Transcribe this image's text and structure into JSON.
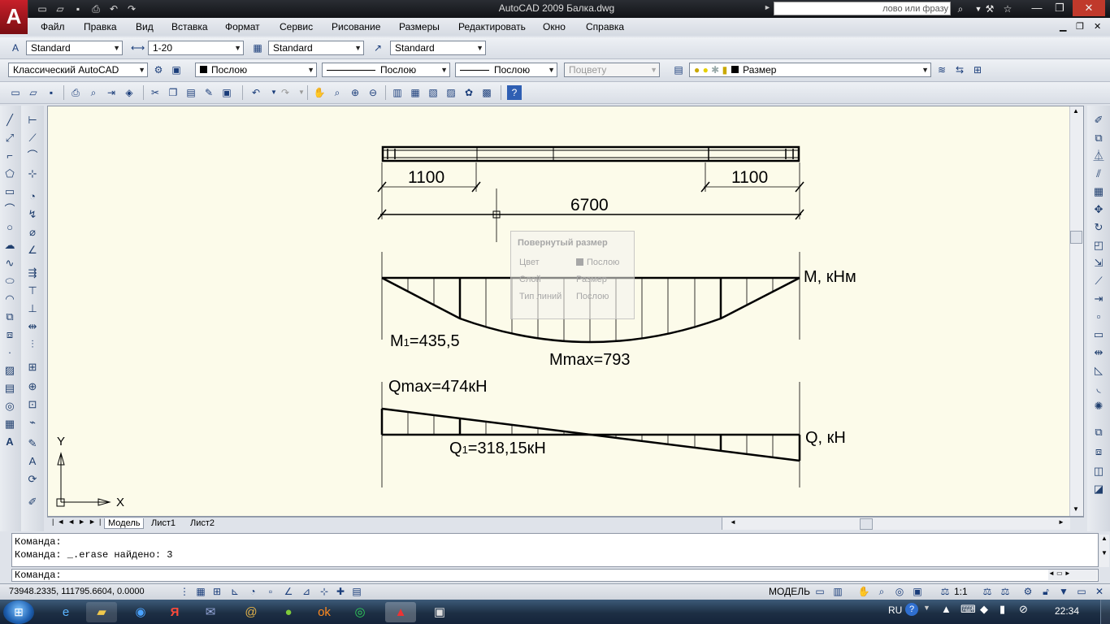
{
  "window": {
    "title": "AutoCAD 2009  Балка.dwg",
    "search_placeholder": "лово или фразу",
    "min_icon": "minimize-icon",
    "max_icon": "maximize-icon",
    "close_icon": "close-icon"
  },
  "menu": [
    "Файл",
    "Правка",
    "Вид",
    "Вставка",
    "Формат",
    "Сервис",
    "Рисование",
    "Размеры",
    "Редактировать",
    "Окно",
    "Справка"
  ],
  "styles_toolbar": {
    "text_style": "Standard",
    "dim_style": "1-20",
    "table_style": "Standard",
    "mleader_style": "Standard"
  },
  "layers_toolbar": {
    "workspace": "Классический AutoCAD",
    "color": "Послою",
    "linetype": "Послою",
    "lineweight": "Послою",
    "plotstyle": "Поцвету",
    "layer": "Размер"
  },
  "drawing": {
    "dim_left": "1100",
    "dim_right": "1100",
    "dim_total": "6700",
    "m_label": "М, кНм",
    "m1_label": "M",
    "m1_sub": "1",
    "m1_value": "=435,5",
    "mmax_label": "Mmax=793",
    "qmax_label": "Qmax=474кН",
    "q1_label": "Q",
    "q1_sub": "1",
    "q1_value": "=318,15кН",
    "q_label": "Q, кН",
    "ucs_y": "Y",
    "ucs_x": "X"
  },
  "tooltip": {
    "title": "Повернутый размер",
    "rows": [
      {
        "key": "Цвет",
        "value": "Послою"
      },
      {
        "key": "Слой",
        "value": "Размер"
      },
      {
        "key": "Тип линий",
        "value": "Послою"
      }
    ]
  },
  "tabs": [
    "Модель",
    "Лист1",
    "Лист2"
  ],
  "command": {
    "line1": "Команда:",
    "line2": "Команда: _.erase найдено: 3",
    "prompt": "Команда:"
  },
  "status": {
    "coords": "73948.2335, 111795.6604, 0.0000",
    "model": "МОДЕЛЬ",
    "scale": "1:1"
  },
  "taskbar": {
    "lang": "RU",
    "time": "22:34"
  }
}
